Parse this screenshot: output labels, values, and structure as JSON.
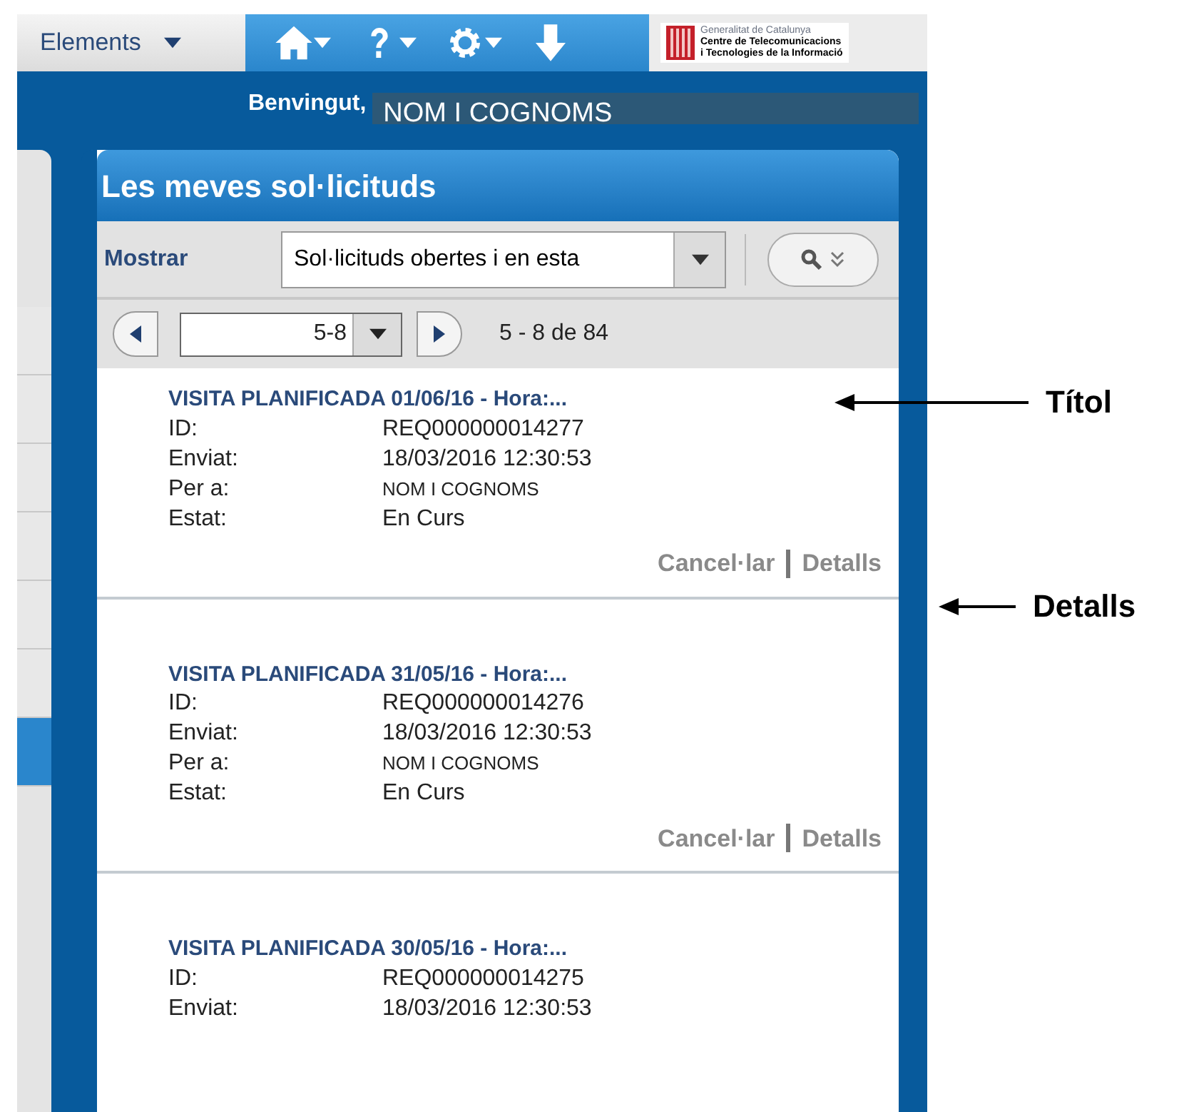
{
  "toolbar": {
    "menu_label": "Elements",
    "icons": [
      {
        "kind": "home",
        "has_caret": true
      },
      {
        "kind": "help",
        "has_caret": true
      },
      {
        "kind": "settings",
        "has_caret": true
      },
      {
        "kind": "download",
        "has_caret": false
      }
    ],
    "logo_lines": [
      "Generalitat de Catalunya",
      "Centre de Telecomunicacions",
      "i Tecnologies de la Informació"
    ]
  },
  "welcome": {
    "label": "Benvingut,",
    "user": "NOM I COGNOMS"
  },
  "sidebar": {
    "items": [
      {
        "selected": false
      },
      {
        "selected": false
      },
      {
        "selected": false
      },
      {
        "selected": false
      },
      {
        "selected": false
      },
      {
        "selected": false
      },
      {
        "selected": true
      }
    ]
  },
  "panel": {
    "title": "Les meves sol·licituds",
    "filter_label": "Mostrar",
    "filter_value": "Sol·licituds obertes i en esta",
    "pager_value": "5-8",
    "pager_summary": "5 - 8 de 84"
  },
  "requests": [
    {
      "title": "VISITA PLANIFICADA 01/06/16 - Hora:...",
      "fields": [
        {
          "label": "ID:",
          "value": "REQ000000014277"
        },
        {
          "label": "Enviat:",
          "value": "18/03/2016 12:30:53"
        },
        {
          "label": "Per a:",
          "value": "NOM I COGNOMS",
          "small": true
        },
        {
          "label": "Estat:",
          "value": "En Curs"
        }
      ],
      "actions": [
        "Cancel·lar",
        "Detalls"
      ]
    },
    {
      "title": "VISITA PLANIFICADA 31/05/16 - Hora:...",
      "fields": [
        {
          "label": "ID:",
          "value": "REQ000000014276"
        },
        {
          "label": "Enviat:",
          "value": "18/03/2016 12:30:53"
        },
        {
          "label": "Per a:",
          "value": "NOM I COGNOMS",
          "small": true
        },
        {
          "label": "Estat:",
          "value": "En Curs"
        }
      ],
      "actions": [
        "Cancel·lar",
        "Detalls"
      ]
    },
    {
      "title": "VISITA PLANIFICADA 30/05/16 - Hora:...",
      "fields": [
        {
          "label": "ID:",
          "value": "REQ000000014275"
        },
        {
          "label": "Enviat:",
          "value": "18/03/2016 12:30:53"
        }
      ]
    }
  ],
  "annotations": [
    {
      "kind": "title",
      "label": "Títol"
    },
    {
      "kind": "details",
      "label": "Detalls"
    }
  ]
}
